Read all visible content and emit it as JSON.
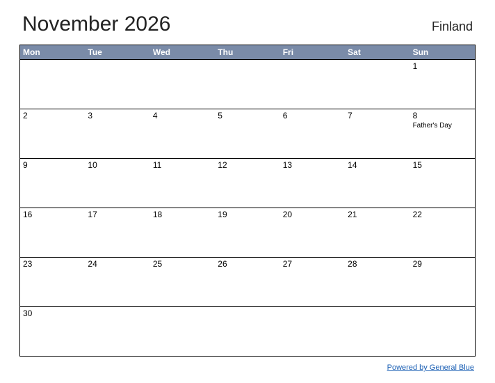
{
  "header": {
    "title": "November 2026",
    "region": "Finland"
  },
  "weekdays": [
    "Mon",
    "Tue",
    "Wed",
    "Thu",
    "Fri",
    "Sat",
    "Sun"
  ],
  "weeks": [
    [
      {
        "day": "",
        "event": ""
      },
      {
        "day": "",
        "event": ""
      },
      {
        "day": "",
        "event": ""
      },
      {
        "day": "",
        "event": ""
      },
      {
        "day": "",
        "event": ""
      },
      {
        "day": "",
        "event": ""
      },
      {
        "day": "1",
        "event": ""
      }
    ],
    [
      {
        "day": "2",
        "event": ""
      },
      {
        "day": "3",
        "event": ""
      },
      {
        "day": "4",
        "event": ""
      },
      {
        "day": "5",
        "event": ""
      },
      {
        "day": "6",
        "event": ""
      },
      {
        "day": "7",
        "event": ""
      },
      {
        "day": "8",
        "event": "Father's Day"
      }
    ],
    [
      {
        "day": "9",
        "event": ""
      },
      {
        "day": "10",
        "event": ""
      },
      {
        "day": "11",
        "event": ""
      },
      {
        "day": "12",
        "event": ""
      },
      {
        "day": "13",
        "event": ""
      },
      {
        "day": "14",
        "event": ""
      },
      {
        "day": "15",
        "event": ""
      }
    ],
    [
      {
        "day": "16",
        "event": ""
      },
      {
        "day": "17",
        "event": ""
      },
      {
        "day": "18",
        "event": ""
      },
      {
        "day": "19",
        "event": ""
      },
      {
        "day": "20",
        "event": ""
      },
      {
        "day": "21",
        "event": ""
      },
      {
        "day": "22",
        "event": ""
      }
    ],
    [
      {
        "day": "23",
        "event": ""
      },
      {
        "day": "24",
        "event": ""
      },
      {
        "day": "25",
        "event": ""
      },
      {
        "day": "26",
        "event": ""
      },
      {
        "day": "27",
        "event": ""
      },
      {
        "day": "28",
        "event": ""
      },
      {
        "day": "29",
        "event": ""
      }
    ],
    [
      {
        "day": "30",
        "event": ""
      },
      {
        "day": "",
        "event": ""
      },
      {
        "day": "",
        "event": ""
      },
      {
        "day": "",
        "event": ""
      },
      {
        "day": "",
        "event": ""
      },
      {
        "day": "",
        "event": ""
      },
      {
        "day": "",
        "event": ""
      }
    ]
  ],
  "footer": {
    "link": "Powered by General Blue"
  }
}
